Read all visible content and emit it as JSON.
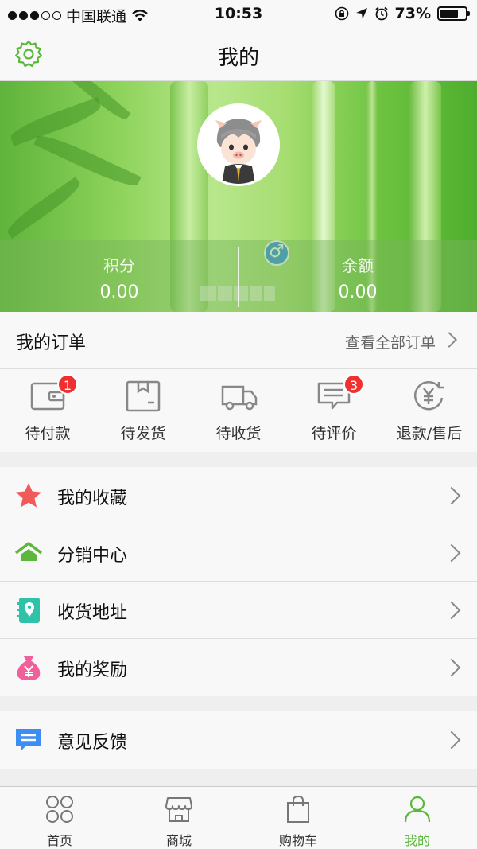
{
  "status_bar": {
    "carrier": "中国联通",
    "time": "10:53",
    "battery": "73%",
    "battery_level": 0.73
  },
  "header": {
    "title": "我的",
    "settings_icon": "gear-icon"
  },
  "profile": {
    "gender_symbol": "♂",
    "stats": [
      {
        "label": "积分",
        "value": "0.00"
      },
      {
        "label": "余额",
        "value": "0.00"
      }
    ]
  },
  "orders": {
    "title": "我的订单",
    "view_all": "查看全部订单",
    "items": [
      {
        "label": "待付款",
        "icon": "wallet-icon",
        "badge": "1"
      },
      {
        "label": "待发货",
        "icon": "box-icon",
        "badge": ""
      },
      {
        "label": "待收货",
        "icon": "truck-icon",
        "badge": ""
      },
      {
        "label": "待评价",
        "icon": "comment-icon",
        "badge": "3"
      },
      {
        "label": "退款/售后",
        "icon": "refund-yen-icon",
        "badge": ""
      }
    ]
  },
  "menu_group_1": [
    {
      "label": "我的收藏",
      "icon": "star-icon"
    },
    {
      "label": "分销中心",
      "icon": "home-icon"
    },
    {
      "label": "收货地址",
      "icon": "location-book-icon"
    },
    {
      "label": "我的奖励",
      "icon": "money-bag-icon"
    }
  ],
  "menu_group_2": [
    {
      "label": "意见反馈",
      "icon": "feedback-icon"
    }
  ],
  "tabbar": [
    {
      "label": "首页",
      "icon": "grid-icon",
      "active": false
    },
    {
      "label": "商城",
      "icon": "store-icon",
      "active": false
    },
    {
      "label": "购物车",
      "icon": "bag-icon",
      "active": false
    },
    {
      "label": "我的",
      "icon": "person-icon",
      "active": true
    }
  ],
  "colors": {
    "accent": "#5cb83c",
    "badge": "#f03030",
    "gender": "#2f8ee6"
  }
}
